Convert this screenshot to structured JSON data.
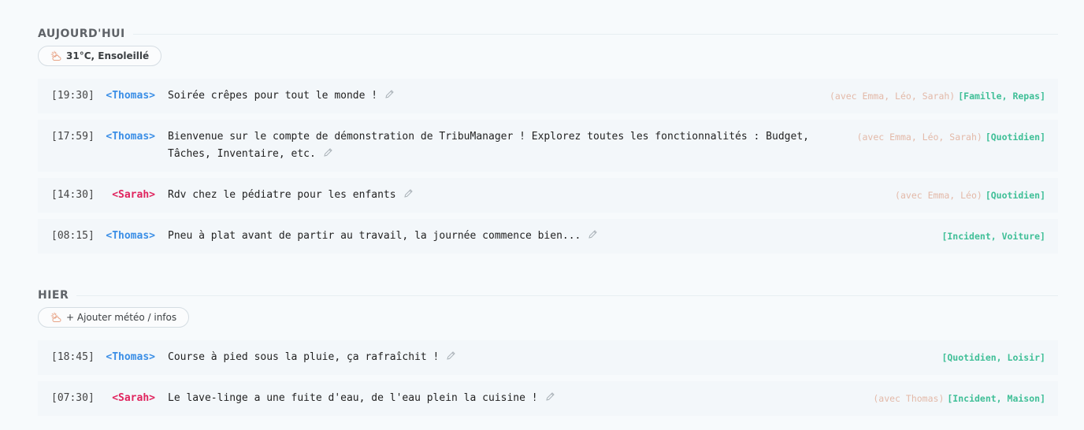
{
  "sections": [
    {
      "title": "AUJOURD'HUI",
      "weather": {
        "icon": "sun-cloud-icon",
        "text": "31°C, Ensoleillé"
      },
      "entries": [
        {
          "time": "[19:30]",
          "author": "<Thomas>",
          "text": "Soirée crêpes pour tout le monde !",
          "with": "(avec Emma, Léo, Sarah)",
          "tags": "[Famille, Repas]"
        },
        {
          "time": "[17:59]",
          "author": "<Thomas>",
          "text": "Bienvenue sur le compte de démonstration de TribuManager ! Explorez toutes les fonctionnalités : Budget, Tâches, Inventaire, etc.",
          "with": "(avec Emma, Léo, Sarah)",
          "tags": "[Quotidien]"
        },
        {
          "time": "[14:30]",
          "author": "<Sarah>",
          "text": "Rdv chez le pédiatre pour les enfants",
          "with": "(avec Emma, Léo)",
          "tags": "[Quotidien]"
        },
        {
          "time": "[08:15]",
          "author": "<Thomas>",
          "text": "Pneu à plat avant de partir au travail, la journée commence bien...",
          "with": "",
          "tags": "[Incident, Voiture]"
        }
      ]
    },
    {
      "title": "HIER",
      "weather": {
        "icon": "sun-cloud-icon",
        "text": "+ Ajouter météo / infos"
      },
      "entries": [
        {
          "time": "[18:45]",
          "author": "<Thomas>",
          "text": "Course à pied sous la pluie, ça rafraîchit !",
          "with": "",
          "tags": "[Quotidien, Loisir]"
        },
        {
          "time": "[07:30]",
          "author": "<Sarah>",
          "text": "Le lave-linge a une fuite d'eau, de l'eau plein la cuisine !",
          "with": "(avec Thomas)",
          "tags": "[Incident, Maison]"
        }
      ]
    }
  ],
  "colors": {
    "thomas": "#3a8ee6",
    "sarah": "#e0245e",
    "tags": "#3fbf97",
    "with": "#e3b9a8"
  }
}
